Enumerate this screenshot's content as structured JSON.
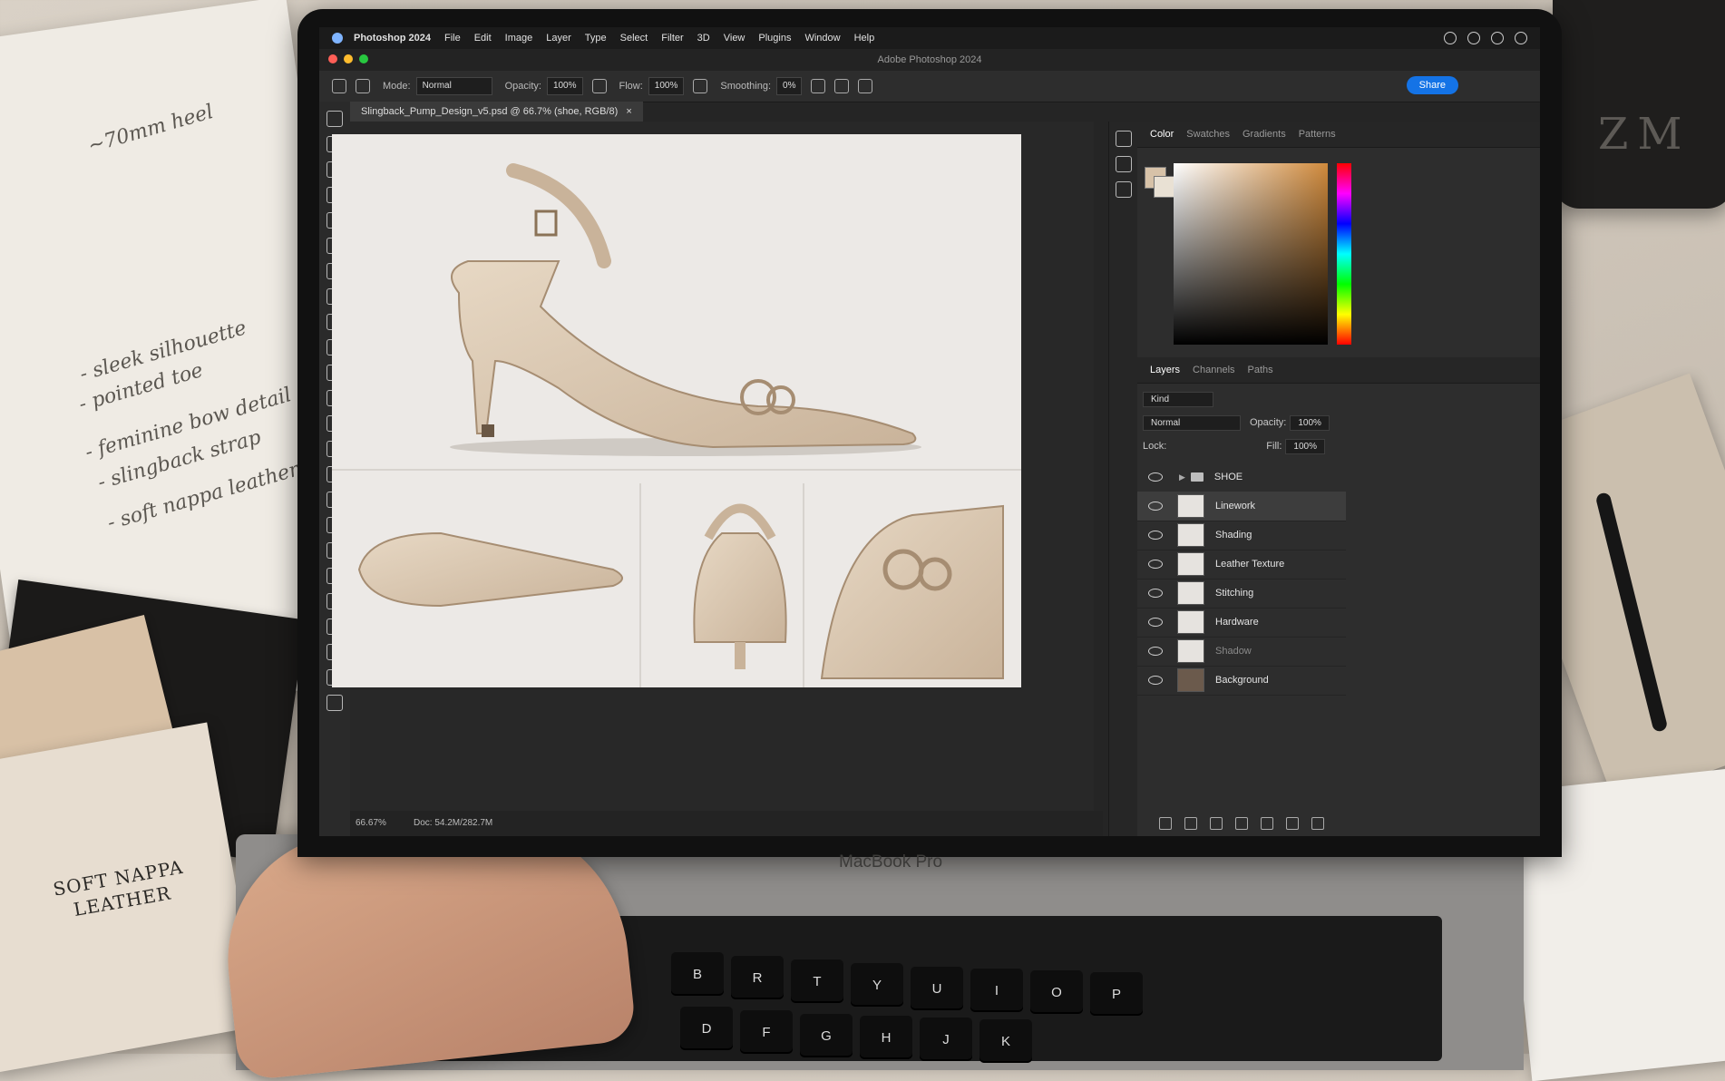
{
  "desk": {
    "sketch_notes": [
      "~70mm heel",
      "- sleek silhouette",
      "- pointed toe",
      "- feminine bow detail",
      "- slingback strap",
      "- soft nappa leather"
    ],
    "book_label_line1": "SOFT NAPPA",
    "book_label_line2": "LEATHER",
    "mug_text": "ZM",
    "laptop_label": "MacBook Pro",
    "keys": [
      "B",
      "R",
      "T",
      "Y",
      "U",
      "I",
      "O",
      "P",
      "D",
      "F",
      "G",
      "H",
      "J",
      "K"
    ]
  },
  "app": {
    "menubar": [
      "Photoshop 2024",
      "File",
      "Edit",
      "Image",
      "Layer",
      "Type",
      "Select",
      "Filter",
      "3D",
      "View",
      "Plugins",
      "Window",
      "Help"
    ],
    "window_title": "Adobe Photoshop 2024",
    "traffic_light_colors": [
      "#ff5f57",
      "#febc2e",
      "#28c840"
    ]
  },
  "options": {
    "mode_label": "Mode:",
    "mode_value": "Normal",
    "opacity_label": "Opacity:",
    "opacity_value": "100%",
    "flow_label": "Flow:",
    "flow_value": "100%",
    "smoothing_label": "Smoothing:",
    "smoothing_value": "0%",
    "share_label": "Share",
    "accent": "#1473e6"
  },
  "document": {
    "tab_title": "Slingback_Pump_Design_v5.psd @ 66.7% (shoe, RGB/8)",
    "tab_close": "×",
    "zoom": "66.67%",
    "doc_size": "Doc: 54.2M/282.7M"
  },
  "color_panel": {
    "tabs": [
      "Color",
      "Swatches",
      "Gradients",
      "Patterns"
    ]
  },
  "layers_panel": {
    "tabs": [
      "Layers",
      "Channels",
      "Paths"
    ],
    "filter_value": "Kind",
    "blend_mode": "Normal",
    "opacity_label": "Opacity:",
    "opacity_value": "100%",
    "lock_label": "Lock:",
    "fill_label": "Fill:",
    "fill_value": "100%",
    "group_name": "SHOE",
    "layers": [
      "Linework",
      "Shading",
      "Leather Texture",
      "Stitching",
      "Hardware",
      "Shadow",
      "Background"
    ]
  }
}
